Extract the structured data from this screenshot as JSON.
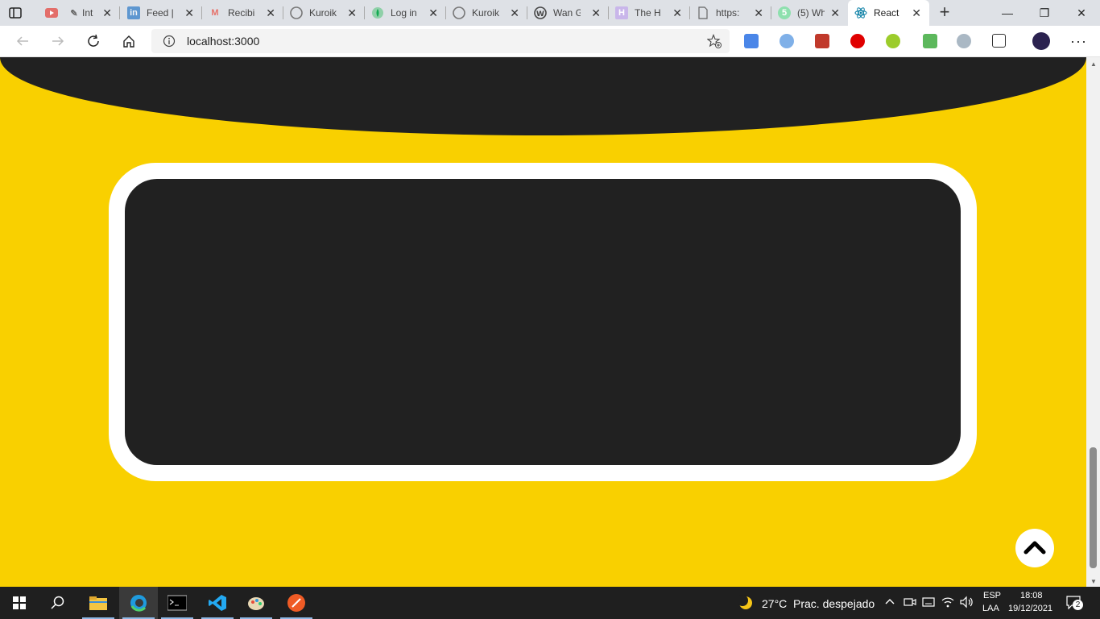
{
  "browser": {
    "tabs": [
      {
        "title": "Int",
        "favicon": "youtube-icon",
        "color": "#e62117"
      },
      {
        "title": "Feed |",
        "favicon": "linkedin-icon",
        "color": "#0a66c2"
      },
      {
        "title": "Recibi",
        "favicon": "gmail-icon",
        "color": "#ea4335"
      },
      {
        "title": "Kuroik",
        "favicon": "github-icon",
        "color": "#333333"
      },
      {
        "title": "Log in",
        "favicon": "mongodb-icon",
        "color": "#13aa52"
      },
      {
        "title": "Kuroik",
        "favicon": "github-icon",
        "color": "#333333"
      },
      {
        "title": "Wan G",
        "favicon": "wordpress-icon",
        "color": "#464646"
      },
      {
        "title": "The H",
        "favicon": "hackerrank-icon",
        "color": "#9b7cd6"
      },
      {
        "title": "https:",
        "favicon": "page-icon",
        "color": "#666666"
      },
      {
        "title": "(5) Wh",
        "favicon": "whatsapp-icon",
        "color": "#25d366"
      },
      {
        "title": "React",
        "favicon": "react-icon",
        "color": "#087ea4",
        "active": true
      }
    ],
    "address": {
      "url": "localhost:3000"
    }
  },
  "page": {
    "background": "#f9d000",
    "dark": "#212121",
    "scroll_top_icon": "chevron-up-icon"
  },
  "taskbar": {
    "weather": {
      "temp": "27°C",
      "desc": "Prac. despejado"
    },
    "lang": {
      "line1": "ESP",
      "line2": "LAA"
    },
    "clock": {
      "time": "18:08",
      "date": "19/12/2021"
    },
    "notifications": "2"
  }
}
